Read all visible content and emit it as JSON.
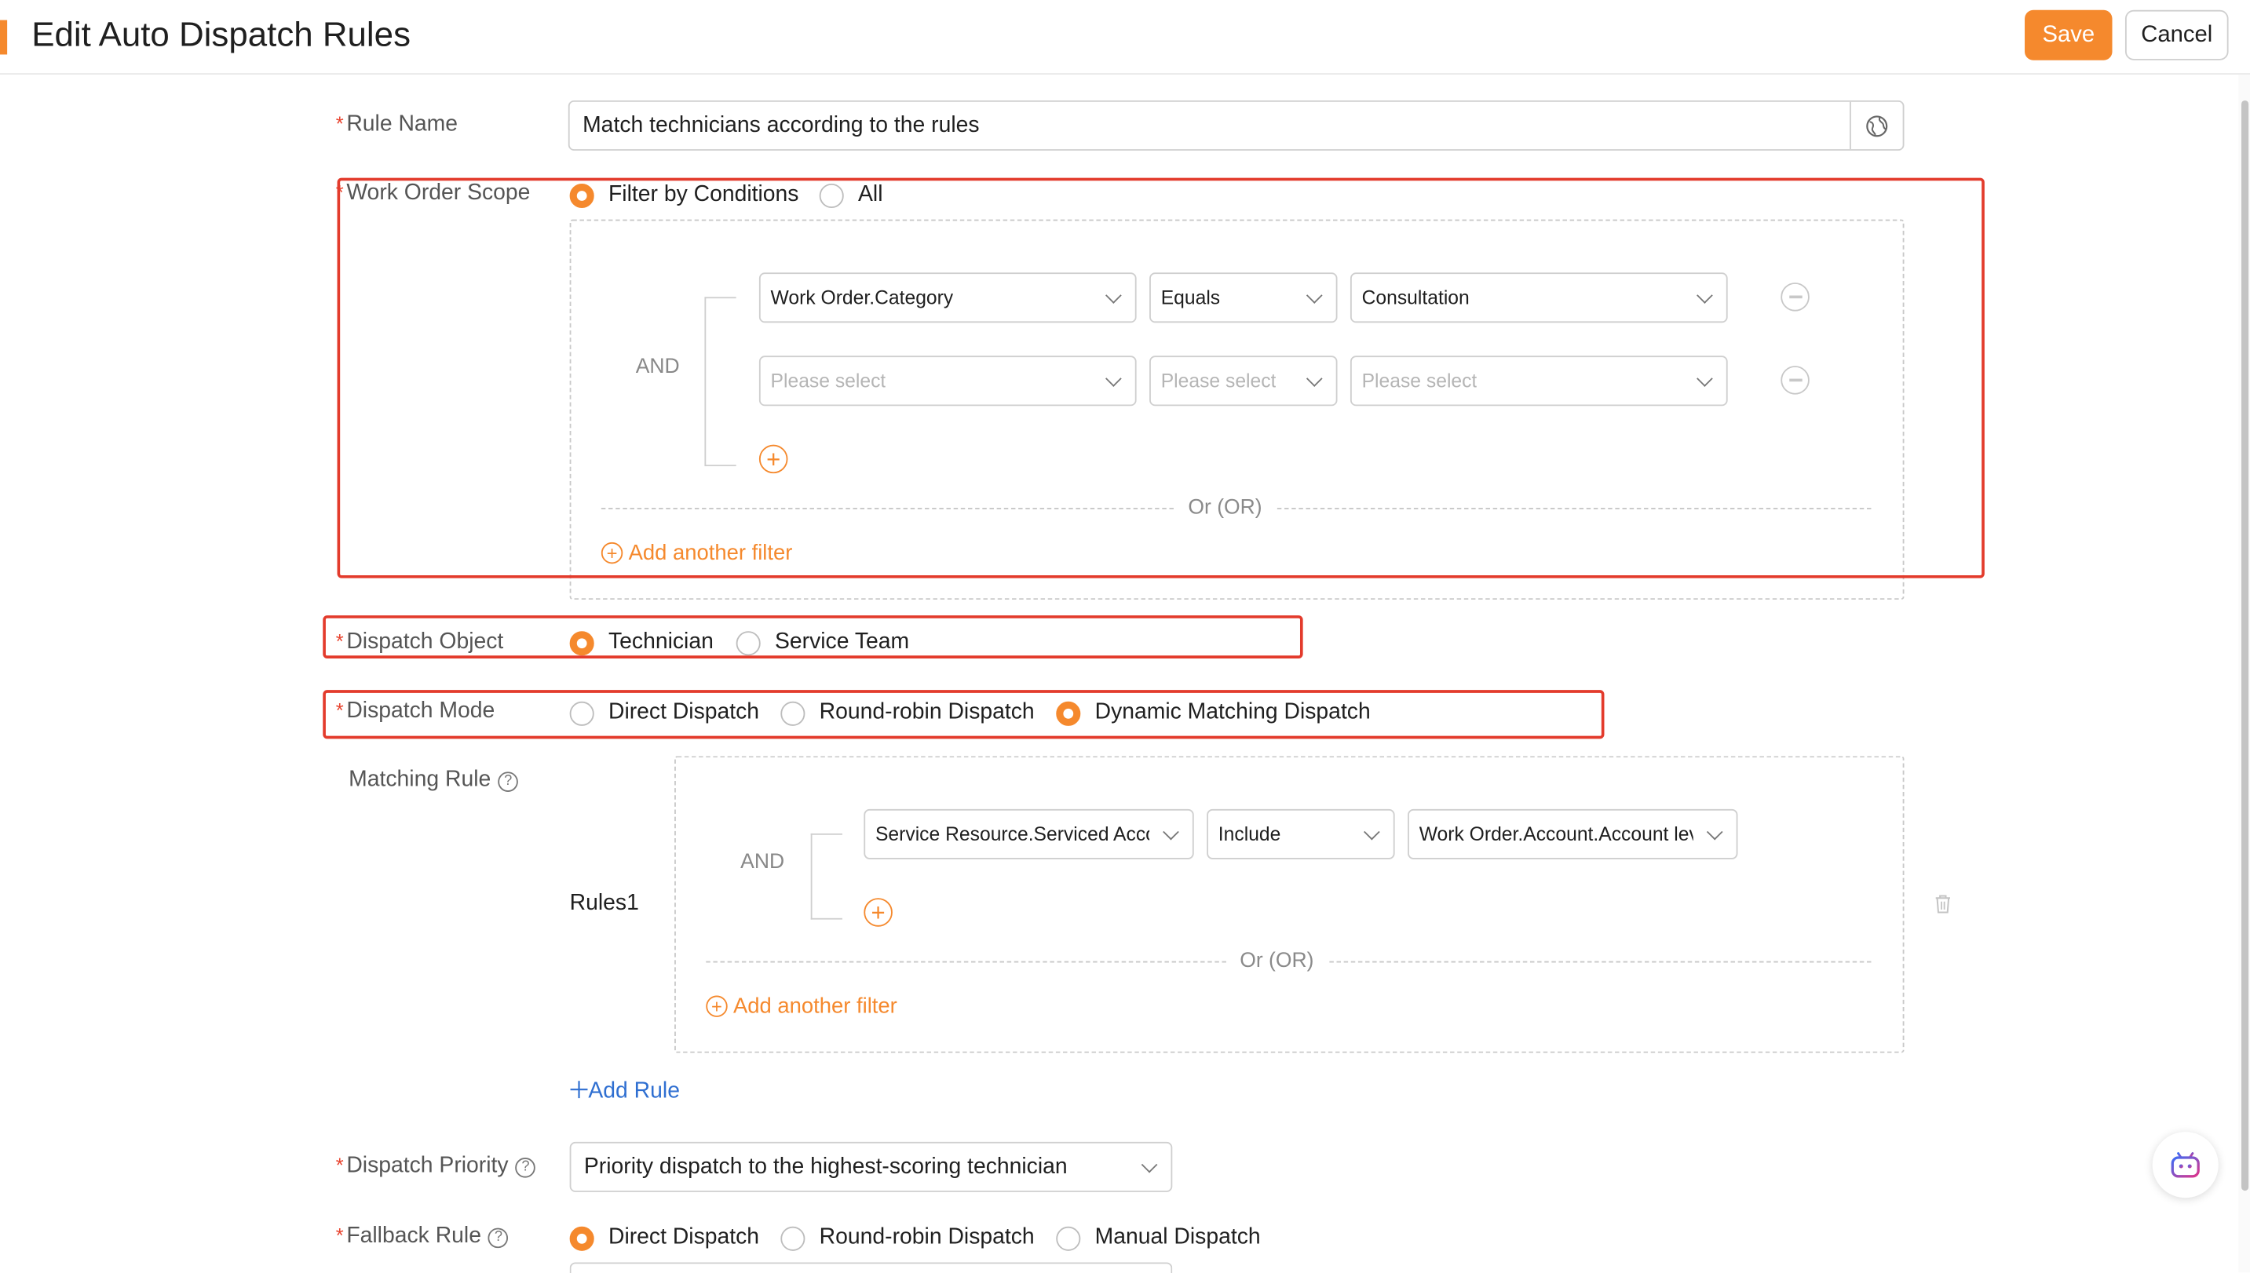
{
  "header": {
    "title": "Edit Auto Dispatch Rules",
    "save_label": "Save",
    "cancel_label": "Cancel"
  },
  "form": {
    "rule_name": {
      "label": "Rule Name",
      "value": "Match technicians according to the rules"
    },
    "work_order_scope": {
      "label": "Work Order Scope",
      "options": [
        "Filter by Conditions",
        "All"
      ],
      "selected": "Filter by Conditions",
      "logic": "AND",
      "conditions": [
        {
          "field": "Work Order.Category",
          "operator": "Equals",
          "value": "Consultation"
        },
        {
          "field_placeholder": "Please select",
          "operator_placeholder": "Please select",
          "value_placeholder": "Please select"
        }
      ],
      "or_label": "Or (OR)",
      "add_filter_label": "Add another filter"
    },
    "dispatch_object": {
      "label": "Dispatch Object",
      "options": [
        "Technician",
        "Service Team"
      ],
      "selected": "Technician"
    },
    "dispatch_mode": {
      "label": "Dispatch Mode",
      "options": [
        "Direct Dispatch",
        "Round-robin Dispatch",
        "Dynamic Matching Dispatch"
      ],
      "selected": "Dynamic Matching Dispatch"
    },
    "matching_rule": {
      "label": "Matching Rule",
      "rule_name": "Rules1",
      "logic": "AND",
      "condition": {
        "field": "Service Resource.Serviced Acco",
        "operator": "Include",
        "value": "Work Order.Account.Account lev"
      },
      "or_label": "Or (OR)",
      "add_filter_label": "Add another filter",
      "add_rule_label": "Add Rule"
    },
    "dispatch_priority": {
      "label": "Dispatch Priority",
      "value": "Priority dispatch to the highest-scoring technician"
    },
    "fallback_rule": {
      "label": "Fallback Rule",
      "options": [
        "Direct Dispatch",
        "Round-robin Dispatch",
        "Manual Dispatch"
      ],
      "selected": "Direct Dispatch"
    }
  },
  "colors": {
    "accent": "#f5892d",
    "highlight_box": "#e33b2c",
    "link_blue": "#2f6fd1"
  }
}
